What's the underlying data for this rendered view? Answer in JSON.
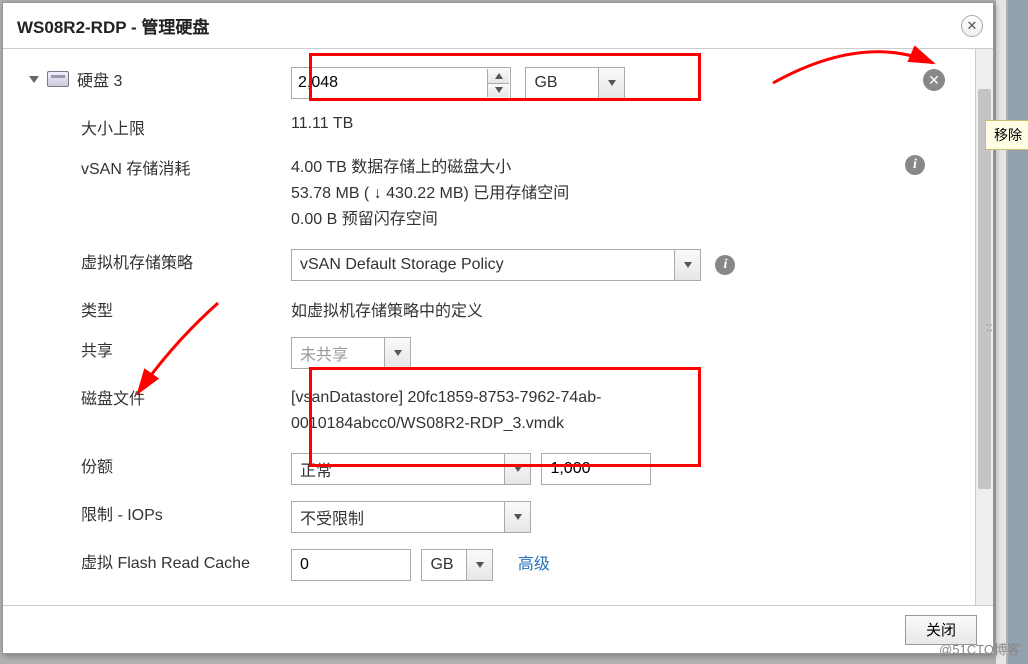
{
  "window": {
    "title": "WS08R2-RDP - 管理硬盘",
    "close_button_label": "关闭",
    "remove_tooltip": "移除"
  },
  "disk": {
    "name": "硬盘 3",
    "size_value": "2,048",
    "size_unit": "GB",
    "max_size_label": "大小上限",
    "max_size_value": "11.11 TB",
    "vsan_label": "vSAN 存储消耗",
    "vsan_line1": "4.00 TB 数据存储上的磁盘大小",
    "vsan_line2": "53.78 MB ( ↓ 430.22 MB) 已用存储空间",
    "vsan_line3": "0.00 B 预留闪存空间",
    "policy_label": "虚拟机存储策略",
    "policy_value": "vSAN Default Storage Policy",
    "type_label": "类型",
    "type_value": "如虚拟机存储策略中的定义",
    "share_label": "共享",
    "share_value": "未共享",
    "file_label": "磁盘文件",
    "file_value": "[vsanDatastore] 20fc1859-8753-7962-74ab-0010184abcc0/WS08R2-RDP_3.vmdk",
    "quota_label": "份额",
    "quota_value": "正常",
    "quota_num": "1,000",
    "iops_label": "限制 - IOPs",
    "iops_value": "不受限制",
    "flash_label": "虚拟 Flash Read Cache",
    "flash_value": "0",
    "flash_unit": "GB",
    "advanced_label": "高级"
  },
  "watermark": "@51CTO博客"
}
